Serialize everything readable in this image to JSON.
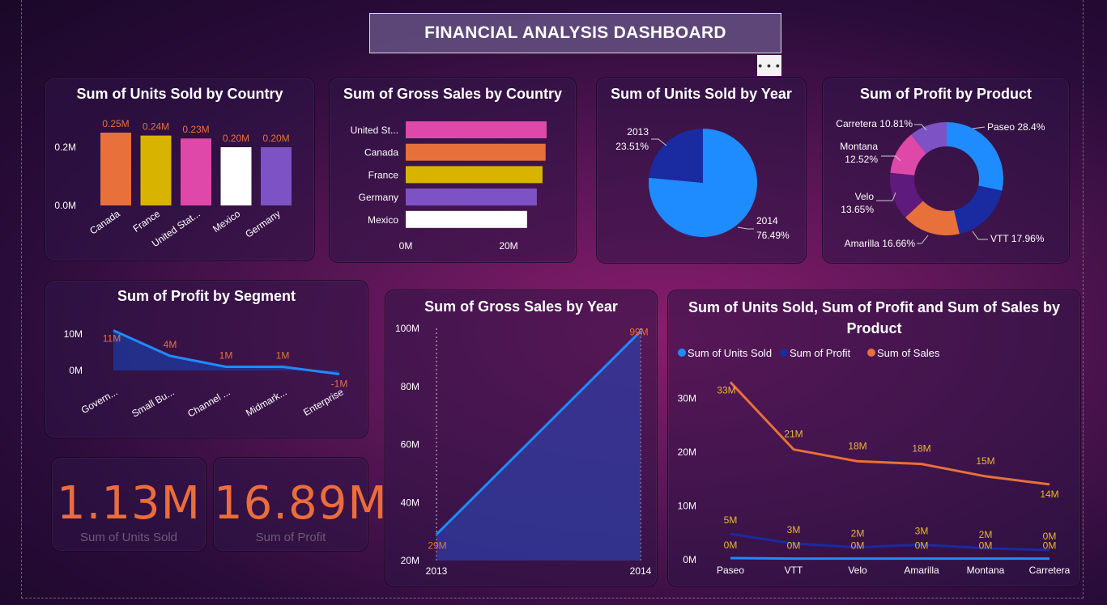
{
  "header": {
    "title": "FINANCIAL ANALYSIS DASHBOARD",
    "more_label": "• • •"
  },
  "colors": {
    "orange": "#e8703a",
    "yellow": "#d8b400",
    "pink": "#df48a8",
    "white": "#ffffff",
    "purple": "#7d52c4",
    "blue": "#1e8bff",
    "navy": "#1a2aa0"
  },
  "kpis": [
    {
      "value": "1.13M",
      "label": "Sum of Units Sold"
    },
    {
      "value": "16.89M",
      "label": "Sum of Profit"
    }
  ],
  "chart_data": [
    {
      "id": "units_by_country",
      "type": "bar",
      "title": "Sum of Units Sold by Country",
      "categories": [
        "Canada",
        "France",
        "United Stat...",
        "Mexico",
        "Germany"
      ],
      "values": [
        0.25,
        0.24,
        0.23,
        0.2,
        0.2
      ],
      "data_labels": [
        "0.25M",
        "0.24M",
        "0.23M",
        "0.20M",
        "0.20M"
      ],
      "y_ticks": [
        "0.0M",
        "0.2M"
      ],
      "ylim": [
        0,
        0.25
      ]
    },
    {
      "id": "gross_by_country",
      "type": "bar",
      "orientation": "horizontal",
      "title": "Sum of Gross Sales by Country",
      "categories": [
        "United St...",
        "Canada",
        "France",
        "Germany",
        "Mexico"
      ],
      "values": [
        27.4,
        27.2,
        26.6,
        25.5,
        23.6
      ],
      "x_ticks": [
        "0M",
        "20M"
      ],
      "xlim": [
        0,
        28
      ]
    },
    {
      "id": "units_by_year",
      "type": "pie",
      "title": "Sum of Units Sold by Year",
      "labels": [
        "2014",
        "2013"
      ],
      "values": [
        76.49,
        23.51
      ],
      "data_labels": [
        "76.49%",
        "23.51%"
      ]
    },
    {
      "id": "profit_by_product",
      "type": "pie",
      "style": "donut",
      "title": "Sum of Profit by Product",
      "labels": [
        "Paseo",
        "VTT",
        "Amarilla",
        "Velo",
        "Montana",
        "Carretera"
      ],
      "values": [
        28.4,
        17.96,
        16.66,
        13.65,
        12.52,
        10.81
      ],
      "data_labels": [
        "28.4%",
        "17.96%",
        "16.66%",
        "13.65%",
        "12.52%",
        "10.81%"
      ]
    },
    {
      "id": "profit_by_segment",
      "type": "area",
      "title": "Sum of Profit by Segment",
      "categories": [
        "Govern...",
        "Small Bu...",
        "Channel ...",
        "Midmark...",
        "Enterprise"
      ],
      "values": [
        11,
        4,
        1,
        1,
        -1
      ],
      "data_labels": [
        "11M",
        "4M",
        "1M",
        "1M",
        "-1M"
      ],
      "y_ticks": [
        "0M",
        "10M"
      ]
    },
    {
      "id": "gross_by_year",
      "type": "area",
      "title": "Sum of Gross Sales by Year",
      "categories": [
        "2013",
        "2014"
      ],
      "values": [
        29,
        99
      ],
      "data_labels": [
        "29M",
        "99M"
      ],
      "y_ticks": [
        "20M",
        "40M",
        "60M",
        "80M",
        "100M"
      ],
      "ylim": [
        20,
        100
      ]
    },
    {
      "id": "units_profit_sales_by_product",
      "type": "line",
      "title": "Sum of Units Sold, Sum of Profit and Sum of Sales by Product",
      "categories": [
        "Paseo",
        "VTT",
        "Velo",
        "Amarilla",
        "Montana",
        "Carretera"
      ],
      "y_ticks": [
        "0M",
        "10M",
        "20M",
        "30M"
      ],
      "ylim": [
        0,
        35
      ],
      "series": [
        {
          "name": "Sum of Units Sold",
          "values": [
            0.3,
            0.2,
            0.2,
            0.2,
            0.2,
            0.2
          ],
          "data_labels": [
            "0M",
            "0M",
            "0M",
            "0M",
            "0M",
            "0M"
          ]
        },
        {
          "name": "Sum of Profit",
          "values": [
            4.8,
            3.0,
            2.3,
            2.8,
            2.1,
            1.8
          ],
          "data_labels": [
            "5M",
            "3M",
            "2M",
            "3M",
            "2M",
            "0M"
          ]
        },
        {
          "name": "Sum of  Sales",
          "values": [
            33,
            20.5,
            18.3,
            17.8,
            15.5,
            14
          ],
          "data_labels": [
            "33M",
            "21M",
            "18M",
            "18M",
            "15M",
            "14M"
          ]
        }
      ]
    }
  ]
}
